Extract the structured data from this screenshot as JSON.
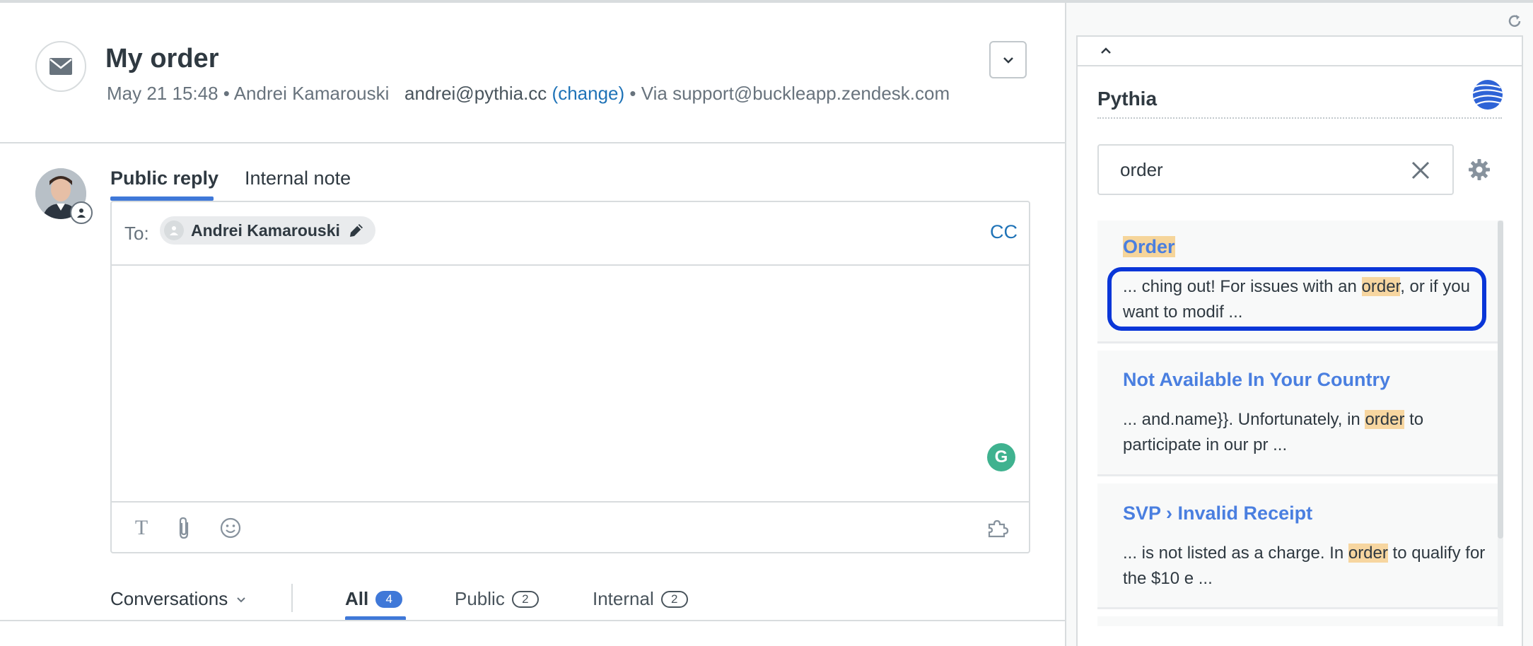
{
  "ticket": {
    "title": "My order",
    "meta": {
      "date": "May 21 15:48",
      "separator": "•",
      "requester": "Andrei Kamarouski",
      "email": "andrei@pythia.cc",
      "change_link": "(change)",
      "via": "Via support@buckleapp.zendesk.com"
    },
    "channel_icon": "envelope-icon",
    "expand_icon": "chevron-down-icon"
  },
  "composer": {
    "tabs": [
      {
        "label": "Public reply",
        "active": true
      },
      {
        "label": "Internal note",
        "active": false
      }
    ],
    "to_label": "To:",
    "recipient": "Andrei Kamarouski",
    "cc_label": "CC",
    "toolbar_icons": [
      "text-format-icon",
      "attachment-icon",
      "emoji-icon",
      "puzzle-icon"
    ],
    "text_tool_glyph": "T",
    "grammarly_glyph": "G"
  },
  "conversations": {
    "dropdown_label": "Conversations",
    "filters": [
      {
        "label": "All",
        "count": "4",
        "active": true
      },
      {
        "label": "Public",
        "count": "2",
        "active": false
      },
      {
        "label": "Internal",
        "count": "2",
        "active": false
      }
    ]
  },
  "app": {
    "title": "Pythia",
    "search_value": "order",
    "results": [
      {
        "title": "Order",
        "snippet_parts": [
          "... ching out! For issues with an ",
          "order",
          ", or if you want to modif ..."
        ]
      },
      {
        "title": "Not Available In Your Country",
        "snippet_parts": [
          "... and.name}}. Unfortunately, in ",
          "order",
          " to participate in our pr ..."
        ]
      },
      {
        "title": "SVP › Invalid Receipt",
        "snippet_parts": [
          "... is not listed as a charge. In ",
          "order",
          " to qualify for the $10 e ..."
        ]
      }
    ]
  },
  "colors": {
    "link_blue": "#1f73b7",
    "result_title_blue": "#4a7fe0",
    "highlight": "#f7d6a0",
    "focus_ring": "#0a36d8",
    "active_tab": "#3f78d8"
  }
}
